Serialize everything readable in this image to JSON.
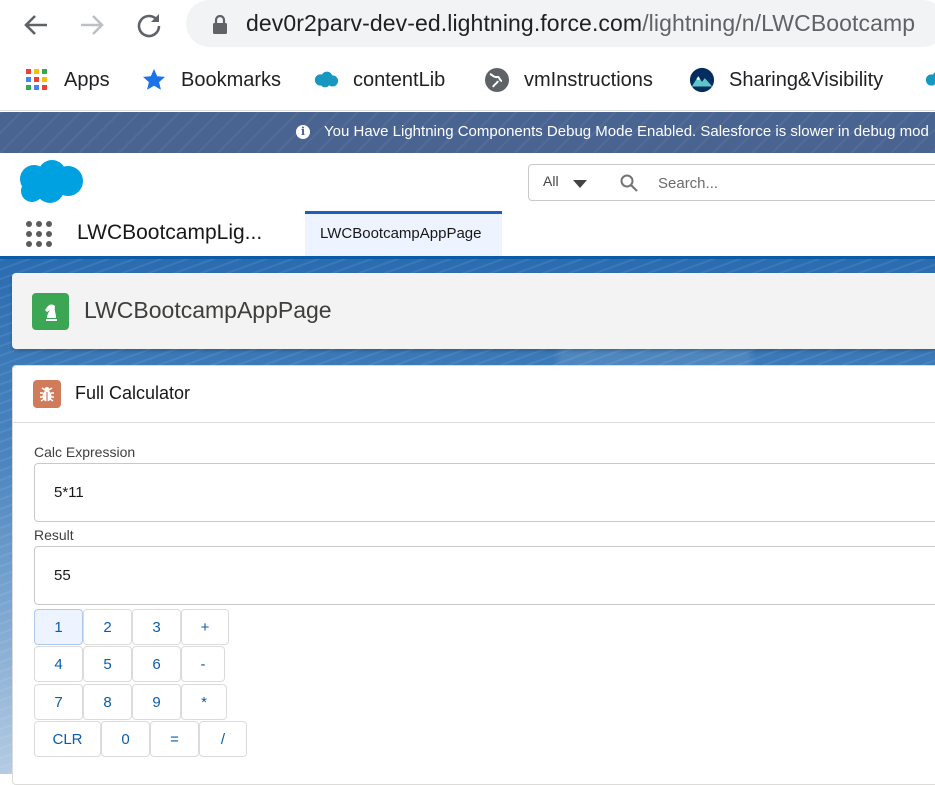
{
  "browser": {
    "url_host": "dev0r2parv-dev-ed.lightning.force.com",
    "url_path": "/lightning/n/LWCBootcamp",
    "bookmarks": [
      {
        "label": "Apps",
        "icon": "apps-grid-icon"
      },
      {
        "label": "Bookmarks",
        "icon": "star-icon"
      },
      {
        "label": "contentLib",
        "icon": "salesforce-cloud-icon"
      },
      {
        "label": "vmInstructions",
        "icon": "globe-icon"
      },
      {
        "label": "Sharing&Visibility",
        "icon": "trailhead-mountain-icon"
      }
    ]
  },
  "debug_banner": {
    "text": "You Have Lightning Components Debug Mode Enabled. Salesforce is slower in debug mod"
  },
  "header": {
    "search_scope": "All",
    "search_placeholder": "Search..."
  },
  "app_nav": {
    "app_name": "LWCBootcampLig...",
    "tabs": [
      {
        "label": "LWCBootcampAppPage",
        "active": true
      }
    ]
  },
  "page": {
    "title": "LWCBootcampAppPage"
  },
  "calculator": {
    "title": "Full Calculator",
    "expression_label": "Calc Expression",
    "expression_value": "5*11",
    "result_label": "Result",
    "result_value": "55",
    "keys": [
      [
        "1",
        "2",
        "3",
        "+"
      ],
      [
        "4",
        "5",
        "6",
        "-"
      ],
      [
        "7",
        "8",
        "9",
        "*"
      ],
      [
        "CLR",
        "0",
        "=",
        "/"
      ]
    ]
  },
  "colors": {
    "banner": "#4a6491",
    "brand_blue": "#0b5cab",
    "page_icon": "#3ba755",
    "card_icon": "#d07b5a"
  }
}
